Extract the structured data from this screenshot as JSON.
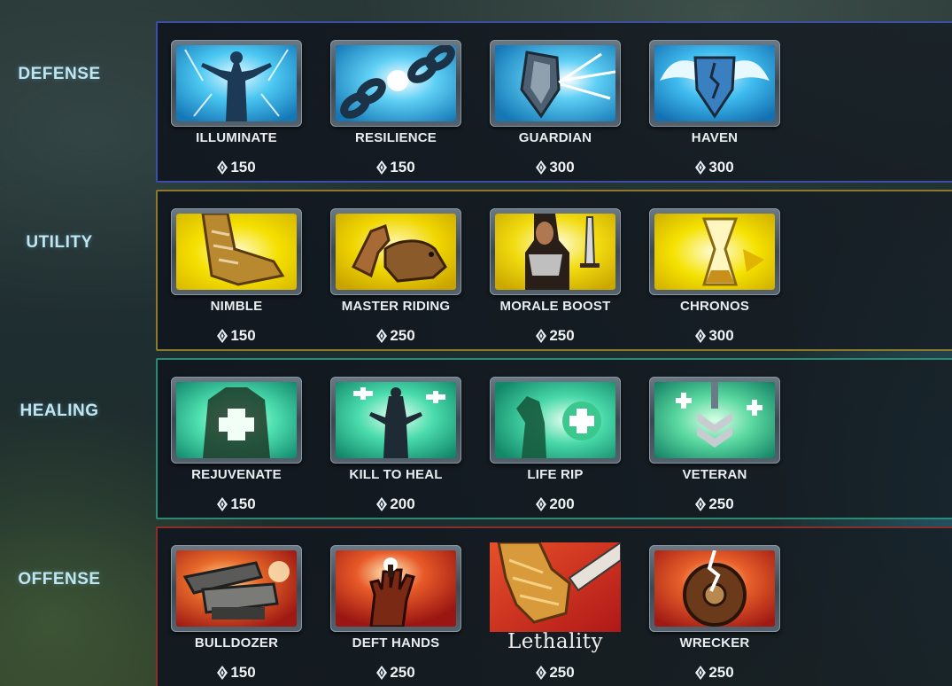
{
  "categories": [
    {
      "label": "DEFENSE",
      "talents": [
        {
          "name": "ILLUMINATE",
          "cost": "150",
          "icon": "illuminate-icon"
        },
        {
          "name": "RESILIENCE",
          "cost": "150",
          "icon": "broken-chain-icon"
        },
        {
          "name": "GUARDIAN",
          "cost": "300",
          "icon": "shield-lightning-icon"
        },
        {
          "name": "HAVEN",
          "cost": "300",
          "icon": "winged-shield-icon"
        }
      ]
    },
    {
      "label": "UTILITY",
      "talents": [
        {
          "name": "NIMBLE",
          "cost": "150",
          "icon": "boot-icon"
        },
        {
          "name": "MASTER RIDING",
          "cost": "250",
          "icon": "mount-rider-icon"
        },
        {
          "name": "MORALE BOOST",
          "cost": "250",
          "icon": "warrior-sword-icon"
        },
        {
          "name": "CHRONOS",
          "cost": "300",
          "icon": "hourglass-icon"
        }
      ]
    },
    {
      "label": "HEALING",
      "talents": [
        {
          "name": "REJUVENATE",
          "cost": "150",
          "icon": "healing-hands-icon"
        },
        {
          "name": "KILL TO HEAL",
          "cost": "200",
          "icon": "gunslinger-heal-icon"
        },
        {
          "name": "LIFE RIP",
          "cost": "200",
          "icon": "life-drain-icon"
        },
        {
          "name": "VETERAN",
          "cost": "250",
          "icon": "chevron-sword-icon"
        }
      ]
    },
    {
      "label": "OFFENSE",
      "talents": [
        {
          "name": "BULLDOZER",
          "cost": "150",
          "icon": "cannon-icon"
        },
        {
          "name": "DEFT HANDS",
          "cost": "250",
          "icon": "hand-grenade-icon"
        },
        {
          "name": "Lethality",
          "cost": "250",
          "icon": "fist-dagger-icon"
        },
        {
          "name": "WRECKER",
          "cost": "250",
          "icon": "cracked-shield-icon"
        }
      ]
    }
  ],
  "colors": {
    "defense_border": "#3a4fa8",
    "utility_border": "#8a7a2c",
    "healing_border": "#2a8a76",
    "offense_border": "#8a2e2c",
    "label": "#bfe6f3",
    "defense_art": "#2fb6ec",
    "utility_art": "#f2d800",
    "healing_art": "#2fd3a8",
    "offense_art": "#d63a2a"
  },
  "currency_icon": "crystal-currency-icon"
}
